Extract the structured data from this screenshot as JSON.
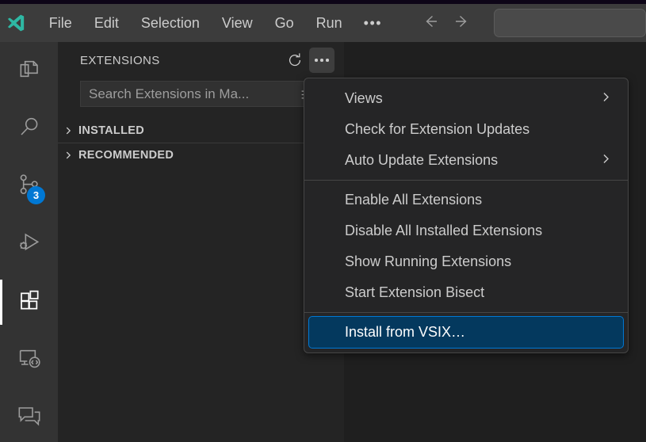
{
  "titlebar": {
    "logo_icon": "vscode-logo-icon",
    "logo_color": "#2eb8a4",
    "menus": [
      "File",
      "Edit",
      "Selection",
      "View",
      "Go",
      "Run"
    ],
    "more_label": "•••",
    "back_icon": "arrow-left-icon",
    "forward_icon": "arrow-right-icon",
    "command_center_value": "",
    "command_center_placeholder": ""
  },
  "activitybar": {
    "items": [
      {
        "name": "explorer",
        "icon": "files-icon",
        "active": false,
        "badge": ""
      },
      {
        "name": "search",
        "icon": "search-icon",
        "active": false,
        "badge": ""
      },
      {
        "name": "source-control",
        "icon": "source-control-icon",
        "active": false,
        "badge": "3"
      },
      {
        "name": "run-and-debug",
        "icon": "run-and-debug-icon",
        "active": false,
        "badge": ""
      },
      {
        "name": "extensions",
        "icon": "extensions-icon",
        "active": true,
        "badge": ""
      },
      {
        "name": "remote-explorer",
        "icon": "remote-explorer-icon",
        "active": false,
        "badge": ""
      },
      {
        "name": "chat",
        "icon": "comment-discussion-icon",
        "active": false,
        "badge": ""
      }
    ],
    "badge_color": "#0078d4"
  },
  "sidebar": {
    "title": "EXTENSIONS",
    "refresh_icon": "refresh-icon",
    "more_actions_icon": "ellipsis-icon",
    "search": {
      "value": "",
      "placeholder": "Search Extensions in Ma...",
      "clear_icon": "clear-filter-icon"
    },
    "tree": [
      {
        "label": "INSTALLED",
        "expanded": false,
        "chevron": "chevron-right-icon"
      },
      {
        "label": "RECOMMENDED",
        "expanded": false,
        "chevron": "chevron-right-icon"
      }
    ]
  },
  "context_menu": {
    "groups": [
      [
        {
          "label": "Views",
          "submenu": true,
          "selected": false
        },
        {
          "label": "Check for Extension Updates",
          "submenu": false,
          "selected": false
        },
        {
          "label": "Auto Update Extensions",
          "submenu": true,
          "selected": false
        }
      ],
      [
        {
          "label": "Enable All Extensions",
          "submenu": false,
          "selected": false
        },
        {
          "label": "Disable All Installed Extensions",
          "submenu": false,
          "selected": false
        },
        {
          "label": "Show Running Extensions",
          "submenu": false,
          "selected": false
        },
        {
          "label": "Start Extension Bisect",
          "submenu": false,
          "selected": false
        }
      ],
      [
        {
          "label": "Install from VSIX…",
          "submenu": false,
          "selected": true
        }
      ]
    ],
    "selected_bg": "#04395e",
    "submenu_icon": "chevron-right-icon"
  }
}
